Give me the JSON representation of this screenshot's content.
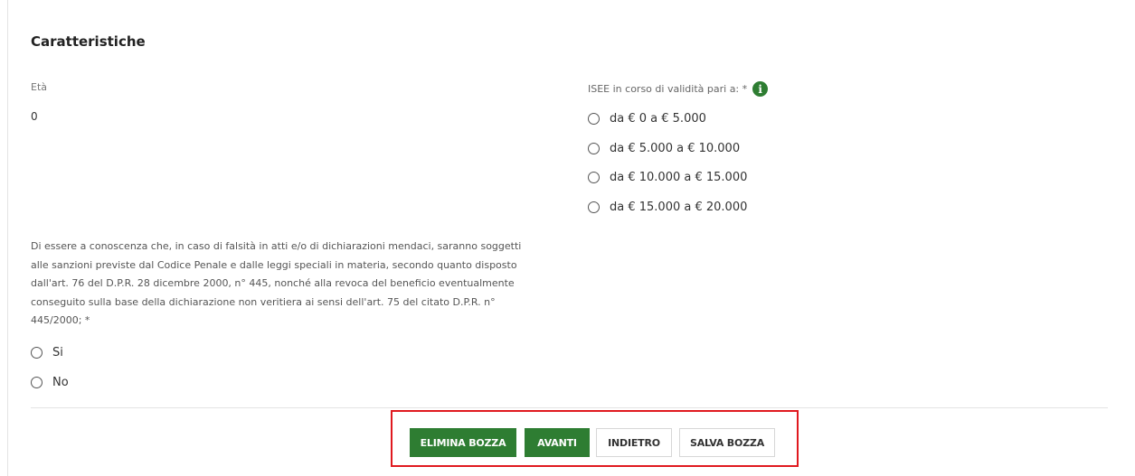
{
  "section": {
    "title": "Caratteristiche"
  },
  "eta": {
    "label": "Età",
    "value": "0"
  },
  "isee": {
    "label": "ISEE in corso di validità pari a: *",
    "info_icon": "info-icon",
    "options": [
      "da € 0 a € 5.000",
      "da € 5.000 a € 10.000",
      "da € 10.000 a € 15.000",
      "da € 15.000 a € 20.000"
    ]
  },
  "declaration": {
    "lines": [
      "Di essere a conoscenza che, in caso di falsità in atti e/o di dichiarazioni mendaci, saranno soggetti",
      "alle sanzioni previste dal Codice Penale e dalle leggi speciali in materia, secondo quanto disposto",
      "dall'art. 76 del D.P.R. 28 dicembre 2000, n° 445, nonché alla revoca del beneficio eventualmente",
      "conseguito sulla base della dichiarazione non veritiera ai sensi dell'art. 75 del citato D.P.R. n°",
      "445/2000; *"
    ],
    "options": [
      "Si",
      "No"
    ]
  },
  "actions": {
    "elimina_bozza": "ELIMINA BOZZA",
    "avanti": "AVANTI",
    "indietro": "INDIETRO",
    "salva_bozza": "SALVA BOZZA"
  },
  "colors": {
    "primary_green": "#2e7d32",
    "highlight_red": "#e0191f"
  }
}
